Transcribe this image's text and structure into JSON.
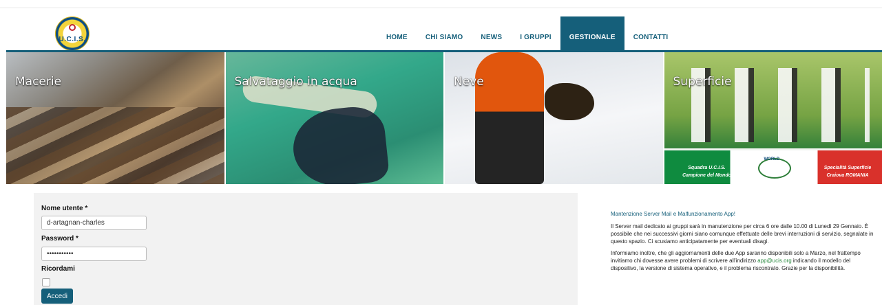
{
  "logo": {
    "text": "U.C.I.S."
  },
  "nav": {
    "items": [
      {
        "label": "HOME"
      },
      {
        "label": "CHI SIAMO"
      },
      {
        "label": "NEWS"
      },
      {
        "label": "I GRUPPI"
      },
      {
        "label": "GESTIONALE"
      },
      {
        "label": "CONTATTI"
      }
    ],
    "active": "GESTIONALE"
  },
  "banner": {
    "tiles": [
      {
        "label": "Macerie"
      },
      {
        "label": "Salvataggio in acqua"
      },
      {
        "label": "Neve"
      },
      {
        "label": "Superficie"
      }
    ],
    "captions": {
      "left": "Squadra U.C.I.S.\nCampione del Mondo",
      "center": "WORLD",
      "right": "Specialità Superficie\nCraiova  ROMANIA"
    }
  },
  "login": {
    "username_label": "Nome utente *",
    "username_value": "d-artagnan-charles",
    "password_label": "Password *",
    "password_value": "•••••••••••",
    "remember_label": "Ricordami",
    "remember_checked": false,
    "submit_label": "Accedi"
  },
  "notice": {
    "title": "Mantenzione Server Mail e Malfunzionamento App!",
    "paragraph1": "Il Server mail dedicato ai gruppi sarà in manutenzione per circa 6 ore dalle 10.00 di Lunedì 29 Gennaio. È possibile che nei successivi giorni siano comunque effettuate delle brevi interruzioni di servizio, segnalate in questo spazio. Ci scusiamo anticipatamente per eventuali disagi.",
    "paragraph2_before": "Informiamo inoltre, che gli aggiornamenti delle due App saranno disponibili solo a Marzo, nel frattempo invitiamo chi dovesse avere problemi di scrivere all'indirizzo ",
    "email": "app@ucis.org",
    "paragraph2_after": " indicando il modello del dispositivo, la versione di sistema operativo, e il problema riscontrato. Grazie per la disponibilità."
  },
  "colors": {
    "accent": "#155f7a",
    "link": "#2a8a3f"
  }
}
